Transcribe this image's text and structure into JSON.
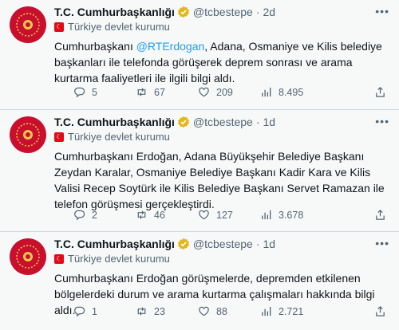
{
  "tweets": [
    {
      "display_name": "T.C. Cumhurbaşkanlığı",
      "handle": "@tcbestepe",
      "separator": "·",
      "time": "2d",
      "affiliation": "Türkiye devlet kurumu",
      "text_before": "Cumhurbaşkanı ",
      "mention": "@RTErdogan",
      "text_after": ", Adana, Osmaniye ve Kilis belediye başkanları ile telefonda görüşerek deprem sonrası ve arama kurtarma faaliyetleri ile ilgili bilgi aldı.",
      "replies": "5",
      "retweets": "67",
      "likes": "209",
      "views": "8.495"
    },
    {
      "display_name": "T.C. Cumhurbaşkanlığı",
      "handle": "@tcbestepe",
      "separator": "·",
      "time": "1d",
      "affiliation": "Türkiye devlet kurumu",
      "text": "Cumhurbaşkanı Erdoğan, Adana Büyükşehir Belediye Başkanı Zeydan Karalar, Osmaniye Belediye Başkanı Kadir Kara ve Kilis Valisi Recep Soytürk ile Kilis Belediye Başkanı Servet Ramazan ile telefon görüşmesi gerçekleştirdi.",
      "replies": "2",
      "retweets": "46",
      "likes": "127",
      "views": "3.678"
    },
    {
      "display_name": "T.C. Cumhurbaşkanlığı",
      "handle": "@tcbestepe",
      "separator": "·",
      "time": "1d",
      "affiliation": "Türkiye devlet kurumu",
      "text": "Cumhurbaşkanı Erdoğan görüşmelerde, depremden etkilenen bölgelerdeki durum ve arama kurtarma çalışmaları hakkında bilgi aldı.",
      "replies": "1",
      "retweets": "23",
      "likes": "88",
      "views": "2.721"
    }
  ],
  "colors": {
    "accent": "#1d9bf0",
    "verified_gold": "#e2b719",
    "avatar_red": "#c8102e",
    "muted": "#536471"
  },
  "icons": [
    "presidential-seal-icon",
    "verified-badge-icon",
    "government-flag-icon",
    "more-icon",
    "reply-icon",
    "retweet-icon",
    "like-icon",
    "views-icon",
    "share-icon"
  ]
}
